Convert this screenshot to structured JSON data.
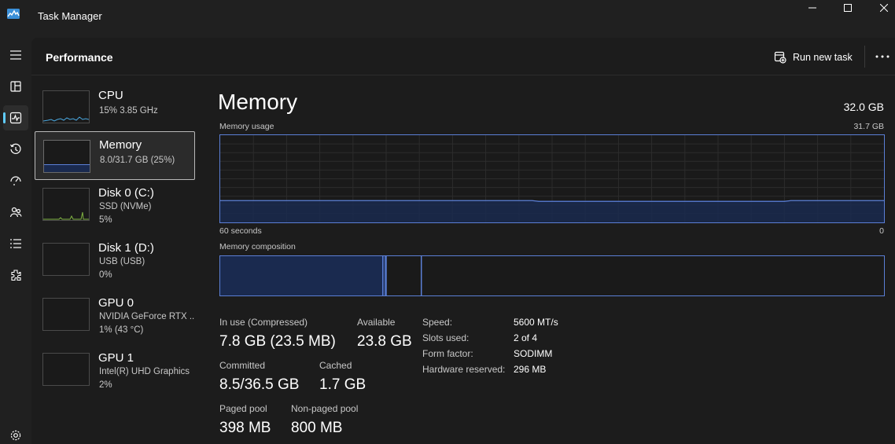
{
  "window": {
    "title": "Task Manager"
  },
  "header": {
    "page_title": "Performance",
    "run_new_task": "Run new task"
  },
  "rail": {
    "items": [
      "menu-icon",
      "processes-icon",
      "performance-icon",
      "app-history-icon",
      "startup-apps-icon",
      "users-icon",
      "details-icon",
      "services-icon",
      "settings-icon"
    ],
    "active": "performance-icon"
  },
  "sidebar": {
    "items": [
      {
        "name": "CPU",
        "line1": "15%  3.85 GHz",
        "line2": ""
      },
      {
        "name": "Memory",
        "line1": "8.0/31.7 GB (25%)",
        "line2": ""
      },
      {
        "name": "Disk 0 (C:)",
        "line1": "SSD (NVMe)",
        "line2": "5%"
      },
      {
        "name": "Disk 1 (D:)",
        "line1": "USB (USB)",
        "line2": "0%"
      },
      {
        "name": "GPU 0",
        "line1": "NVIDIA GeForce RTX ...",
        "line2": "1% (43 °C)"
      },
      {
        "name": "GPU 1",
        "line1": "Intel(R) UHD Graphics",
        "line2": "2%"
      }
    ],
    "selected": "Memory"
  },
  "memory": {
    "title": "Memory",
    "total": "32.0 GB",
    "usage_label": "Memory usage",
    "usage_max": "31.7 GB",
    "time_left": "60 seconds",
    "time_right": "0",
    "usage_level": 0.25,
    "composition_label": "Memory composition",
    "composition": {
      "in_use_fraction": 0.245,
      "modified_fraction": 0.005,
      "standby_fraction": 0.053,
      "free_fraction": 0.697
    },
    "stats": {
      "in_use_label": "In use (Compressed)",
      "in_use_value": "7.8 GB (23.5 MB)",
      "available_label": "Available",
      "available_value": "23.8 GB",
      "committed_label": "Committed",
      "committed_value": "8.5/36.5 GB",
      "cached_label": "Cached",
      "cached_value": "1.7 GB",
      "paged_pool_label": "Paged pool",
      "paged_pool_value": "398 MB",
      "non_paged_pool_label": "Non-paged pool",
      "non_paged_pool_value": "800 MB"
    },
    "specs": [
      {
        "label": "Speed:",
        "value": "5600 MT/s"
      },
      {
        "label": "Slots used:",
        "value": "2 of 4"
      },
      {
        "label": "Form factor:",
        "value": "SODIMM"
      },
      {
        "label": "Hardware reserved:",
        "value": "296 MB"
      }
    ]
  },
  "colors": {
    "accent": "#60cdff",
    "memory_line": "#5b7fd6",
    "memory_fill": "#1a2a4f",
    "cpu_line": "#4aa8e0",
    "disk_line": "#7fb241",
    "background": "#202020",
    "panel": "#1c1c1c"
  }
}
